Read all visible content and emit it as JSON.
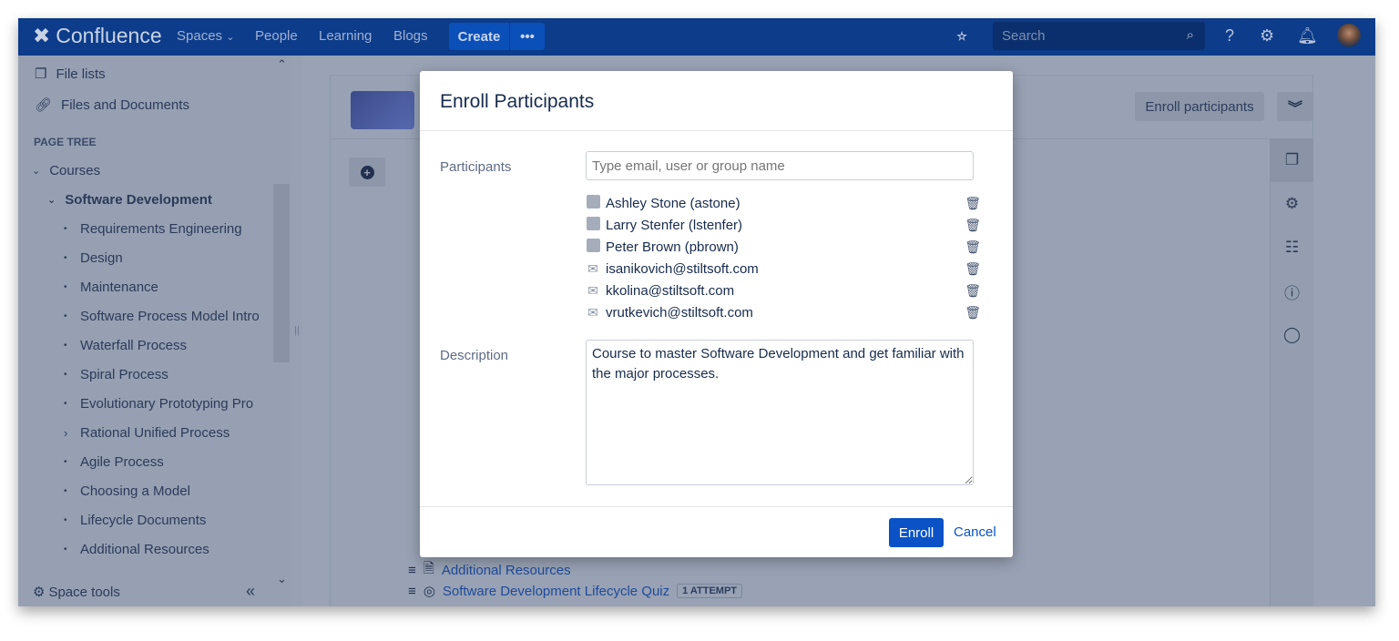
{
  "topbar": {
    "brand": "Confluence",
    "nav": [
      "Spaces",
      "People",
      "Learning",
      "Blogs"
    ],
    "create_label": "Create",
    "more_label": "•••",
    "search_placeholder": "Search"
  },
  "sidebar": {
    "links": [
      "File lists",
      "Files and Documents"
    ],
    "page_tree_heading": "PAGE TREE",
    "tree_root": "Courses",
    "tree_current": "Software Development",
    "tree_items": [
      "Requirements Engineering",
      "Design",
      "Maintenance",
      "Software Process Model Intro",
      "Waterfall Process",
      "Spiral Process",
      "Evolutionary Prototyping Pro",
      "Rational Unified Process",
      "Agile Process",
      "Choosing a Model",
      "Lifecycle Documents",
      "Additional Resources"
    ],
    "space_tools": "Space tools"
  },
  "main": {
    "enroll_participants_label": "Enroll participants",
    "lessons": [
      {
        "title": "Additional Resources"
      },
      {
        "title": "Software Development Lifecycle Quiz",
        "badge": "1 ATTEMPT"
      }
    ]
  },
  "modal": {
    "title": "Enroll Participants",
    "participants_label": "Participants",
    "participants_placeholder": "Type email, user or group name",
    "participants": [
      {
        "name": "Ashley Stone (astone)",
        "type": "user"
      },
      {
        "name": "Larry Stenfer (lstenfer)",
        "type": "user"
      },
      {
        "name": "Peter Brown (pbrown)",
        "type": "user"
      },
      {
        "name": "isanikovich@stiltsoft.com",
        "type": "email"
      },
      {
        "name": "kkolina@stiltsoft.com",
        "type": "email"
      },
      {
        "name": "vrutkevich@stiltsoft.com",
        "type": "email"
      }
    ],
    "description_label": "Description",
    "description_value": "Course to master Software Development and get familiar with the major processes.",
    "enroll_label": "Enroll",
    "cancel_label": "Cancel"
  },
  "colors": {
    "header": "#0c3c8a",
    "primary": "#0a52c5",
    "overlay_bg": "#9aa3b5"
  }
}
